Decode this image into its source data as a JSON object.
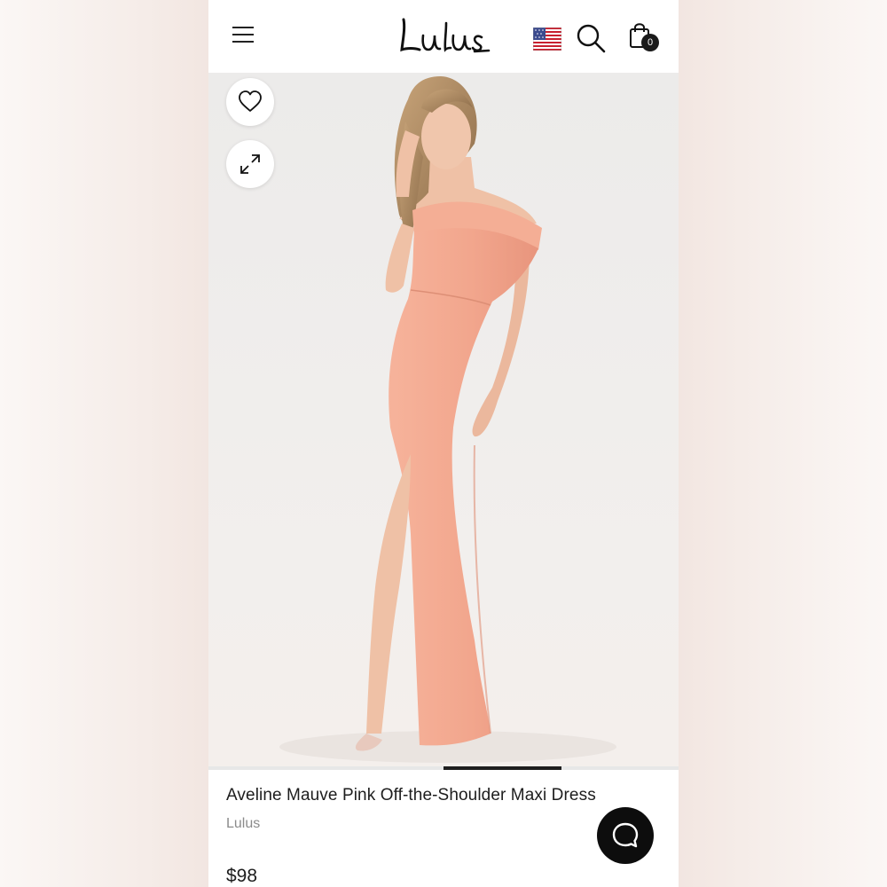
{
  "header": {
    "logo_text": "Lulus",
    "cart_count": "0",
    "icons": [
      "hamburger-menu-icon",
      "us-flag-icon",
      "search-icon",
      "shopping-bag-icon"
    ]
  },
  "gallery": {
    "image_alt": "Model wearing pink off-the-shoulder maxi dress with thigh slit",
    "buttons": [
      "heart-icon",
      "expand-icon"
    ],
    "progress": 0.25,
    "progress_start": 0.5
  },
  "product": {
    "title": "Aveline Mauve Pink Off-the-Shoulder Maxi Dress",
    "brand": "Lulus",
    "price": "$98"
  },
  "colors": {
    "dress": "#f2a88f",
    "accent": "#1a1a1a"
  },
  "chat": {
    "icon": "chat-bubble-icon"
  }
}
